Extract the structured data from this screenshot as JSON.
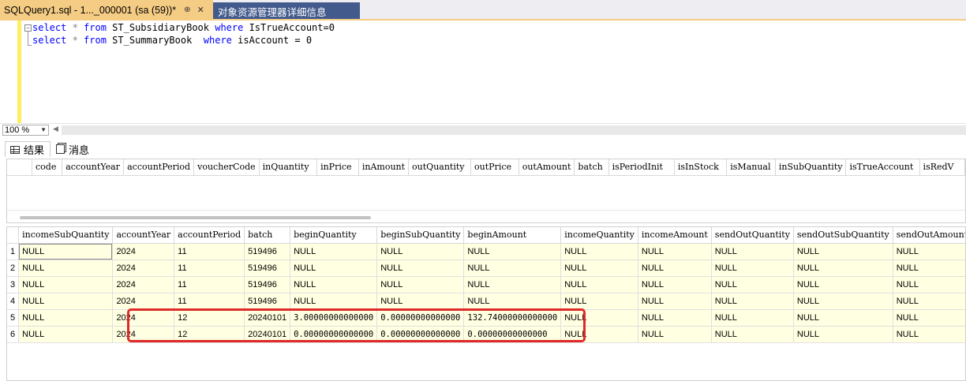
{
  "tabs": {
    "active": {
      "title": "SQLQuery1.sql - 1..._000001 (sa (59))*",
      "pin": "⊕",
      "close": "✕"
    },
    "inactive": {
      "title": "对象资源管理器详细信息"
    }
  },
  "editor": {
    "lines": [
      {
        "kw1": "select",
        "star": " * ",
        "kw2": "from",
        "table": " ST_SubsidiaryBook ",
        "kw3": "where",
        "cond": " IsTrueAccount=0"
      },
      {
        "kw1": "select",
        "star": " * ",
        "kw2": "from",
        "table": " ST_SummaryBook  ",
        "kw3": "where",
        "cond": " isAccount = 0"
      }
    ]
  },
  "zoom": {
    "value": "100 %"
  },
  "results_tabs": {
    "results": "结果",
    "messages": "消息"
  },
  "grid1": {
    "columns": [
      "code",
      "accountYear",
      "accountPeriod",
      "voucherCode",
      "inQuantity",
      "inPrice",
      "inAmount",
      "outQuantity",
      "outPrice",
      "outAmount",
      "batch",
      "isPeriodInit",
      "isInStock",
      "isManual",
      "inSubQuantity",
      "isTrueAccount",
      "isRedV"
    ]
  },
  "grid2": {
    "columns": [
      "incomeSubQuantity",
      "accountYear",
      "accountPeriod",
      "batch",
      "beginQuantity",
      "beginSubQuantity",
      "beginAmount",
      "incomeQuantity",
      "incomeAmount",
      "sendOutQuantity",
      "sendOutSubQuantity",
      "sendOutAmount"
    ],
    "rows": [
      {
        "n": "1",
        "cells": [
          "NULL",
          "2024",
          "11",
          "519496",
          "NULL",
          "NULL",
          "NULL",
          "NULL",
          "NULL",
          "NULL",
          "NULL",
          "NULL"
        ]
      },
      {
        "n": "2",
        "cells": [
          "NULL",
          "2024",
          "11",
          "519496",
          "NULL",
          "NULL",
          "NULL",
          "NULL",
          "NULL",
          "NULL",
          "NULL",
          "NULL"
        ]
      },
      {
        "n": "3",
        "cells": [
          "NULL",
          "2024",
          "11",
          "519496",
          "NULL",
          "NULL",
          "NULL",
          "NULL",
          "NULL",
          "NULL",
          "NULL",
          "NULL"
        ]
      },
      {
        "n": "4",
        "cells": [
          "NULL",
          "2024",
          "11",
          "519496",
          "NULL",
          "NULL",
          "NULL",
          "NULL",
          "NULL",
          "NULL",
          "NULL",
          "NULL"
        ]
      },
      {
        "n": "5",
        "cells": [
          "NULL",
          "2024",
          "12",
          "20240101",
          "3.00000000000000",
          "0.00000000000000",
          "132.74000000000000",
          "NULL",
          "NULL",
          "NULL",
          "NULL",
          "NULL"
        ]
      },
      {
        "n": "6",
        "cells": [
          "NULL",
          "2024",
          "12",
          "20240101",
          "0.00000000000000",
          "0.00000000000000",
          "0.00000000000000",
          "NULL",
          "NULL",
          "NULL",
          "NULL",
          "NULL"
        ]
      }
    ]
  },
  "colors": {
    "active_tab": "#f5cc84",
    "inactive_tab": "#425a8c",
    "editor_margin": "#ffee62",
    "cell_bg": "#ffffe1",
    "highlight": "#e02a2a",
    "keyword": "#0000ff"
  }
}
